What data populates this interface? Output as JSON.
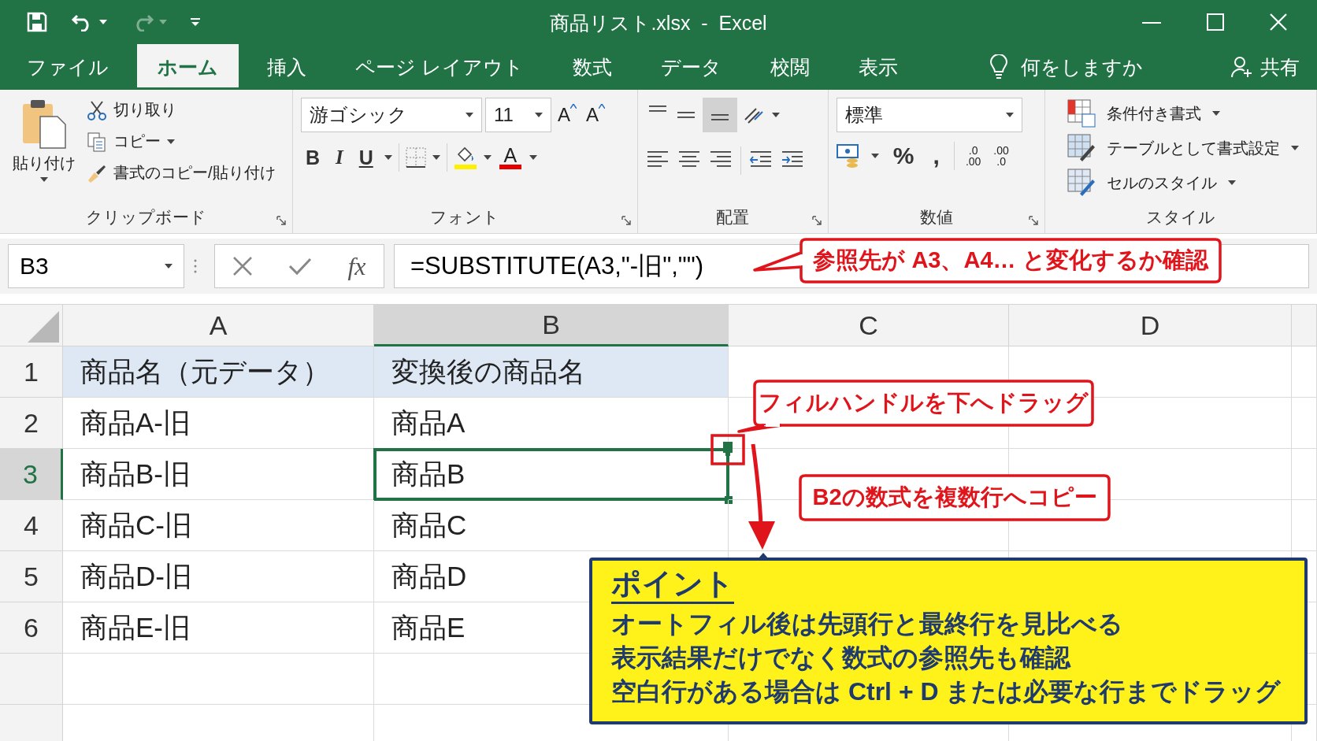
{
  "window": {
    "title": "商品リスト.xlsx  -  Excel",
    "redo_disabled": true
  },
  "tabs": [
    {
      "label": "ファイル",
      "selected": false
    },
    {
      "label": "ホーム",
      "selected": true
    },
    {
      "label": "挿入",
      "selected": false
    },
    {
      "label": "ページ レイアウト",
      "selected": false
    },
    {
      "label": "数式",
      "selected": false
    },
    {
      "label": "データ",
      "selected": false
    },
    {
      "label": "校閲",
      "selected": false
    },
    {
      "label": "表示",
      "selected": false
    }
  ],
  "tell_me": {
    "placeholder": "何をしますか"
  },
  "share": {
    "label": "共有"
  },
  "clipboard": {
    "label": "クリップボード",
    "paste": "貼り付け",
    "cut": "切り取り",
    "copy": "コピー",
    "format_painter": "書式のコピー/貼り付け"
  },
  "font": {
    "label": "フォント",
    "name": "游ゴシック",
    "size": "11",
    "grow": "A",
    "shrink": "A",
    "bold": "B",
    "italic": "I",
    "underline": "U",
    "font_color": "A"
  },
  "alignment": {
    "label": "配置"
  },
  "number": {
    "label": "数値",
    "format": "標準",
    "percent": "%",
    "comma": ",",
    "decimals": [
      {
        "top": ".0",
        "bottom": ".00"
      },
      {
        "top": ".00",
        "bottom": ".0"
      }
    ]
  },
  "styles": {
    "label": "スタイル",
    "items": [
      "条件付き書式",
      "テーブルとして書式設定",
      "セルのスタイル"
    ]
  },
  "formula_bar": {
    "name_box": "B3",
    "fx": "fx",
    "formula": "=SUBSTITUTE(A3,\"-旧\",\"\")"
  },
  "sheet": {
    "columns": [
      {
        "label": "A",
        "selected": false
      },
      {
        "label": "B",
        "selected": true
      },
      {
        "label": "C",
        "selected": false
      },
      {
        "label": "D",
        "selected": false
      }
    ],
    "rows": [
      {
        "number": "1",
        "kind": "header",
        "selected": false,
        "cells": [
          "商品名（元データ）",
          "変換後の商品名"
        ]
      },
      {
        "number": "2",
        "kind": "data",
        "selected": false,
        "cells": [
          "商品A-旧",
          "商品A"
        ]
      },
      {
        "number": "3",
        "kind": "data",
        "selected": true,
        "cells": [
          "商品B-旧",
          "商品B"
        ]
      },
      {
        "number": "4",
        "kind": "data",
        "selected": false,
        "cells": [
          "商品C-旧",
          "商品C"
        ]
      },
      {
        "number": "5",
        "kind": "data",
        "selected": false,
        "cells": [
          "商品D-旧",
          "商品D"
        ]
      },
      {
        "number": "6",
        "kind": "data",
        "selected": false,
        "cells": [
          "商品E-旧",
          "商品E"
        ]
      }
    ]
  },
  "callouts": [
    {
      "text": "参照先が A3、A4… と変化するか確認"
    },
    {
      "text": "フィルハンドルを下へドラッグ"
    },
    {
      "text": "B2の数式を複数行へコピー"
    }
  ],
  "point": {
    "title": "ポイント",
    "lines": [
      "オートフィル後は先頭行と最終行を見比べる",
      "表示結果だけでなく数式の参照先も確認",
      "空白行がある場合は Ctrl + D または必要な行までドラッグ"
    ]
  }
}
